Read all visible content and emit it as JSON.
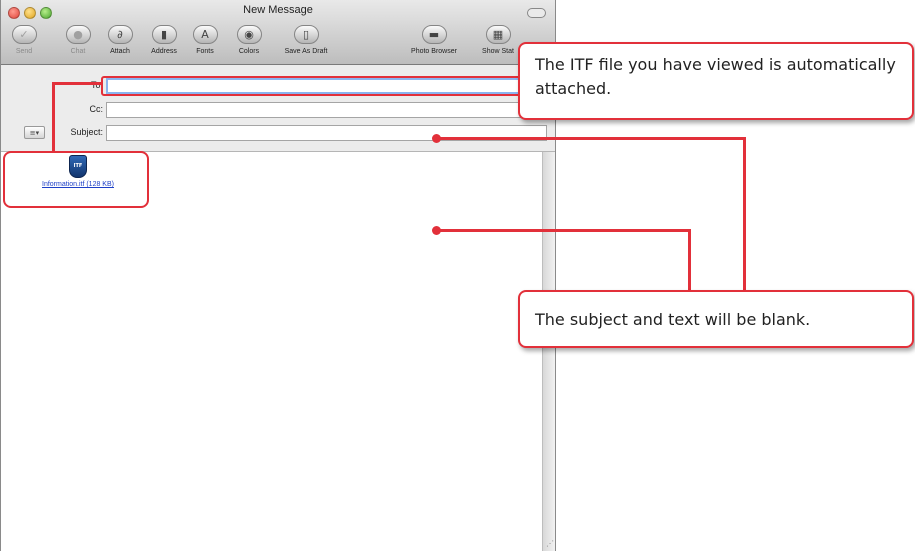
{
  "window": {
    "title": "New Message"
  },
  "toolbar": {
    "items": [
      {
        "label": "Send",
        "icon": "send-icon"
      },
      {
        "label": "Chat",
        "icon": "chat-icon"
      },
      {
        "label": "Attach",
        "icon": "paperclip-icon"
      },
      {
        "label": "Address",
        "icon": "address-book-icon"
      },
      {
        "label": "Fonts",
        "icon": "fonts-icon"
      },
      {
        "label": "Colors",
        "icon": "color-wheel-icon"
      },
      {
        "label": "Save As Draft",
        "icon": "save-draft-icon"
      },
      {
        "label": "Photo Browser",
        "icon": "photo-browser-icon"
      },
      {
        "label": "Show Stat",
        "icon": "stationery-icon"
      }
    ]
  },
  "header": {
    "to_label": "To:",
    "cc_label": "Cc:",
    "subject_label": "Subject:"
  },
  "attachment": {
    "icon_text": "ITF",
    "link_text": "Information.itf (128 KB)"
  },
  "callouts": {
    "attached": "The ITF file you have viewed is automatically attached.",
    "blank": "The subject and text will be blank."
  },
  "colors": {
    "accent": "#e2303a",
    "to_field_focus": "#8ab4ef",
    "link": "#1d3fc7"
  }
}
